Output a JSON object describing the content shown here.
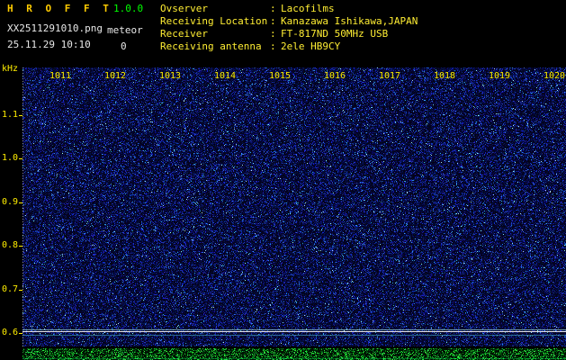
{
  "app": {
    "title": "H R O F F T",
    "version": "1.0.0",
    "filename": "XX2511291010.png",
    "mode": "meteor",
    "datetime": "25.11.29 10:10",
    "count": "0"
  },
  "info": {
    "separator": ":",
    "rows": [
      {
        "label": "Ovserver",
        "value": "Lacofilms"
      },
      {
        "label": "Receiving Location",
        "value": "Kanazawa Ishikawa,JAPAN"
      },
      {
        "label": "Receiver",
        "value": "FT-817ND 50MHz USB"
      },
      {
        "label": "Receiving antenna",
        "value": "2ele HB9CY"
      }
    ]
  },
  "axes": {
    "y_unit": "kHz",
    "y_ticks": [
      "1.1",
      "1.0",
      "0.9",
      "0.8",
      "0.7",
      "0.6"
    ],
    "x_ticks": [
      "1011",
      "1012",
      "1013",
      "1014",
      "1015",
      "1016",
      "1017",
      "1018",
      "1019",
      "1020"
    ]
  },
  "colors": {
    "header_label": "#ffee33",
    "title": "#ffcc00",
    "version": "#00ff00",
    "axis": "#ffee00",
    "background": "#000000"
  },
  "spectrogram": {
    "main": {
      "layers": [
        {
          "p": 0.5,
          "base": [
            0,
            0,
            18
          ],
          "vary": [
            8,
            8,
            32
          ]
        },
        {
          "p": 0.3,
          "base": [
            0,
            4,
            50
          ],
          "vary": [
            10,
            20,
            60
          ]
        },
        {
          "p": 0.17,
          "base": [
            10,
            20,
            110
          ],
          "vary": [
            30,
            50,
            110
          ]
        },
        {
          "p": 0.025,
          "base": [
            30,
            90,
            190
          ],
          "vary": [
            40,
            90,
            65
          ]
        },
        {
          "p": 0.005,
          "base": [
            120,
            200,
            230
          ],
          "vary": [
            60,
            55,
            25
          ]
        }
      ],
      "lines": [
        {
          "y": 291,
          "color": "#9fd8d8",
          "alpha": 0.7,
          "h": 1
        },
        {
          "y": 293,
          "color": "#ffffff",
          "alpha": 0.9,
          "h": 1
        },
        {
          "y": 297,
          "color": "#44aabb",
          "alpha": 0.6,
          "h": 1
        }
      ]
    },
    "strip": {
      "layers": [
        {
          "p": 0.55,
          "base": [
            0,
            8,
            0
          ],
          "vary": [
            0,
            22,
            5
          ]
        },
        {
          "p": 0.3,
          "base": [
            0,
            60,
            10
          ],
          "vary": [
            10,
            90,
            20
          ]
        },
        {
          "p": 0.15,
          "base": [
            20,
            160,
            40
          ],
          "vary": [
            40,
            95,
            40
          ]
        }
      ],
      "lines": [
        {
          "y": 11,
          "color": "#00ff66",
          "alpha": 0.3,
          "h": 1
        }
      ]
    }
  }
}
